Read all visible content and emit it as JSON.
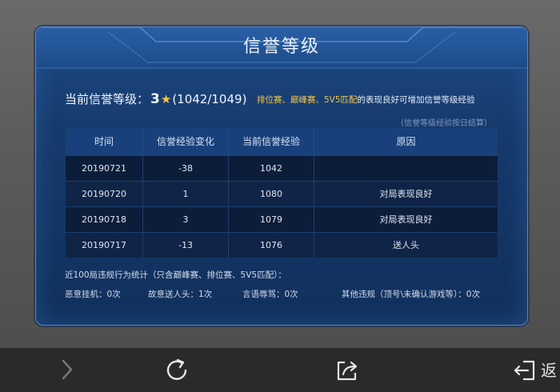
{
  "panel": {
    "title": "信誉等级",
    "level_label": "当前信誉等级：",
    "level_value": "3",
    "level_progress": "(1042/1049)",
    "hint_modes": "排位赛、巅峰赛、5V5匹配",
    "hint_rest": "的表现良好可增加信誉等级经验",
    "note": "（信誉等级经验按日结算）"
  },
  "table": {
    "headers": [
      "时间",
      "信誉经验变化",
      "当前信誉经验",
      "原因"
    ],
    "rows": [
      {
        "date": "20190721",
        "change": "-38",
        "current": "1042",
        "reason": ""
      },
      {
        "date": "20190720",
        "change": "1",
        "current": "1080",
        "reason": "对局表现良好"
      },
      {
        "date": "20190718",
        "change": "3",
        "current": "1079",
        "reason": "对局表现良好"
      },
      {
        "date": "20190717",
        "change": "-13",
        "current": "1076",
        "reason": "送人头"
      }
    ]
  },
  "stats": {
    "title": "近100局违规行为统计（只含巅峰赛、排位赛、5V5匹配）：",
    "afk": "恶意挂机：0次",
    "feeding": "故意送人头：1次",
    "abuse": "言语辱骂：0次",
    "other": "其他违规（顶号\\未确认游戏等）：0次"
  },
  "browser": {
    "back_label": "返"
  },
  "icons": {
    "forward": "chevron-right-icon",
    "refresh": "refresh-icon",
    "share": "share-icon",
    "exit": "exit-icon"
  },
  "colors": {
    "accent_yellow": "#f4c64a",
    "panel_blue": "#163a6c",
    "star": "#f5c542"
  }
}
